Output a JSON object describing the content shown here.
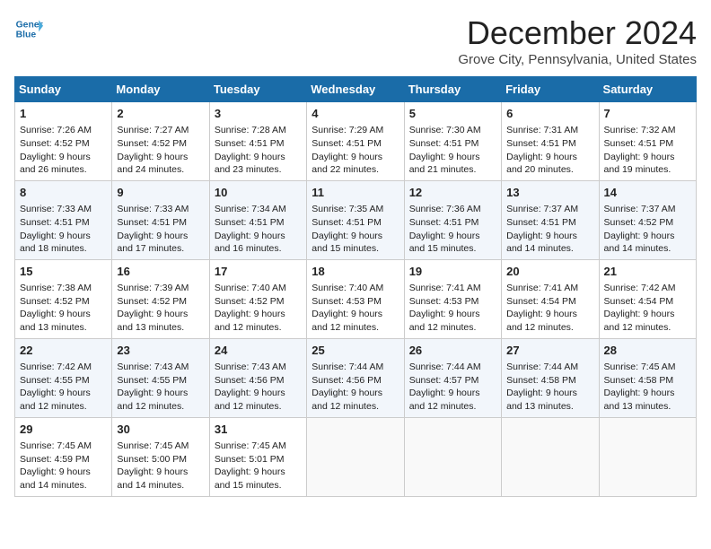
{
  "header": {
    "logo_line1": "General",
    "logo_line2": "Blue",
    "title": "December 2024",
    "subtitle": "Grove City, Pennsylvania, United States"
  },
  "columns": [
    "Sunday",
    "Monday",
    "Tuesday",
    "Wednesday",
    "Thursday",
    "Friday",
    "Saturday"
  ],
  "weeks": [
    [
      {
        "day": "1",
        "rise": "Sunrise: 7:26 AM",
        "set": "Sunset: 4:52 PM",
        "light": "Daylight: 9 hours and 26 minutes."
      },
      {
        "day": "2",
        "rise": "Sunrise: 7:27 AM",
        "set": "Sunset: 4:52 PM",
        "light": "Daylight: 9 hours and 24 minutes."
      },
      {
        "day": "3",
        "rise": "Sunrise: 7:28 AM",
        "set": "Sunset: 4:51 PM",
        "light": "Daylight: 9 hours and 23 minutes."
      },
      {
        "day": "4",
        "rise": "Sunrise: 7:29 AM",
        "set": "Sunset: 4:51 PM",
        "light": "Daylight: 9 hours and 22 minutes."
      },
      {
        "day": "5",
        "rise": "Sunrise: 7:30 AM",
        "set": "Sunset: 4:51 PM",
        "light": "Daylight: 9 hours and 21 minutes."
      },
      {
        "day": "6",
        "rise": "Sunrise: 7:31 AM",
        "set": "Sunset: 4:51 PM",
        "light": "Daylight: 9 hours and 20 minutes."
      },
      {
        "day": "7",
        "rise": "Sunrise: 7:32 AM",
        "set": "Sunset: 4:51 PM",
        "light": "Daylight: 9 hours and 19 minutes."
      }
    ],
    [
      {
        "day": "8",
        "rise": "Sunrise: 7:33 AM",
        "set": "Sunset: 4:51 PM",
        "light": "Daylight: 9 hours and 18 minutes."
      },
      {
        "day": "9",
        "rise": "Sunrise: 7:33 AM",
        "set": "Sunset: 4:51 PM",
        "light": "Daylight: 9 hours and 17 minutes."
      },
      {
        "day": "10",
        "rise": "Sunrise: 7:34 AM",
        "set": "Sunset: 4:51 PM",
        "light": "Daylight: 9 hours and 16 minutes."
      },
      {
        "day": "11",
        "rise": "Sunrise: 7:35 AM",
        "set": "Sunset: 4:51 PM",
        "light": "Daylight: 9 hours and 15 minutes."
      },
      {
        "day": "12",
        "rise": "Sunrise: 7:36 AM",
        "set": "Sunset: 4:51 PM",
        "light": "Daylight: 9 hours and 15 minutes."
      },
      {
        "day": "13",
        "rise": "Sunrise: 7:37 AM",
        "set": "Sunset: 4:51 PM",
        "light": "Daylight: 9 hours and 14 minutes."
      },
      {
        "day": "14",
        "rise": "Sunrise: 7:37 AM",
        "set": "Sunset: 4:52 PM",
        "light": "Daylight: 9 hours and 14 minutes."
      }
    ],
    [
      {
        "day": "15",
        "rise": "Sunrise: 7:38 AM",
        "set": "Sunset: 4:52 PM",
        "light": "Daylight: 9 hours and 13 minutes."
      },
      {
        "day": "16",
        "rise": "Sunrise: 7:39 AM",
        "set": "Sunset: 4:52 PM",
        "light": "Daylight: 9 hours and 13 minutes."
      },
      {
        "day": "17",
        "rise": "Sunrise: 7:40 AM",
        "set": "Sunset: 4:52 PM",
        "light": "Daylight: 9 hours and 12 minutes."
      },
      {
        "day": "18",
        "rise": "Sunrise: 7:40 AM",
        "set": "Sunset: 4:53 PM",
        "light": "Daylight: 9 hours and 12 minutes."
      },
      {
        "day": "19",
        "rise": "Sunrise: 7:41 AM",
        "set": "Sunset: 4:53 PM",
        "light": "Daylight: 9 hours and 12 minutes."
      },
      {
        "day": "20",
        "rise": "Sunrise: 7:41 AM",
        "set": "Sunset: 4:54 PM",
        "light": "Daylight: 9 hours and 12 minutes."
      },
      {
        "day": "21",
        "rise": "Sunrise: 7:42 AM",
        "set": "Sunset: 4:54 PM",
        "light": "Daylight: 9 hours and 12 minutes."
      }
    ],
    [
      {
        "day": "22",
        "rise": "Sunrise: 7:42 AM",
        "set": "Sunset: 4:55 PM",
        "light": "Daylight: 9 hours and 12 minutes."
      },
      {
        "day": "23",
        "rise": "Sunrise: 7:43 AM",
        "set": "Sunset: 4:55 PM",
        "light": "Daylight: 9 hours and 12 minutes."
      },
      {
        "day": "24",
        "rise": "Sunrise: 7:43 AM",
        "set": "Sunset: 4:56 PM",
        "light": "Daylight: 9 hours and 12 minutes."
      },
      {
        "day": "25",
        "rise": "Sunrise: 7:44 AM",
        "set": "Sunset: 4:56 PM",
        "light": "Daylight: 9 hours and 12 minutes."
      },
      {
        "day": "26",
        "rise": "Sunrise: 7:44 AM",
        "set": "Sunset: 4:57 PM",
        "light": "Daylight: 9 hours and 12 minutes."
      },
      {
        "day": "27",
        "rise": "Sunrise: 7:44 AM",
        "set": "Sunset: 4:58 PM",
        "light": "Daylight: 9 hours and 13 minutes."
      },
      {
        "day": "28",
        "rise": "Sunrise: 7:45 AM",
        "set": "Sunset: 4:58 PM",
        "light": "Daylight: 9 hours and 13 minutes."
      }
    ],
    [
      {
        "day": "29",
        "rise": "Sunrise: 7:45 AM",
        "set": "Sunset: 4:59 PM",
        "light": "Daylight: 9 hours and 14 minutes."
      },
      {
        "day": "30",
        "rise": "Sunrise: 7:45 AM",
        "set": "Sunset: 5:00 PM",
        "light": "Daylight: 9 hours and 14 minutes."
      },
      {
        "day": "31",
        "rise": "Sunrise: 7:45 AM",
        "set": "Sunset: 5:01 PM",
        "light": "Daylight: 9 hours and 15 minutes."
      },
      null,
      null,
      null,
      null
    ]
  ]
}
